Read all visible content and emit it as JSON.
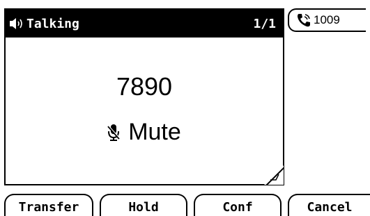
{
  "call": {
    "status": "Talking",
    "count": "1/1",
    "number": "7890",
    "mute_label": "Mute"
  },
  "line_key": {
    "label": "1009"
  },
  "softkeys": {
    "transfer": "Transfer",
    "hold": "Hold",
    "conf": "Conf",
    "cancel": "Cancel"
  },
  "icons": {
    "speaker": "speaker-icon",
    "mic": "mic-icon",
    "phone": "phone-handset-icon"
  }
}
